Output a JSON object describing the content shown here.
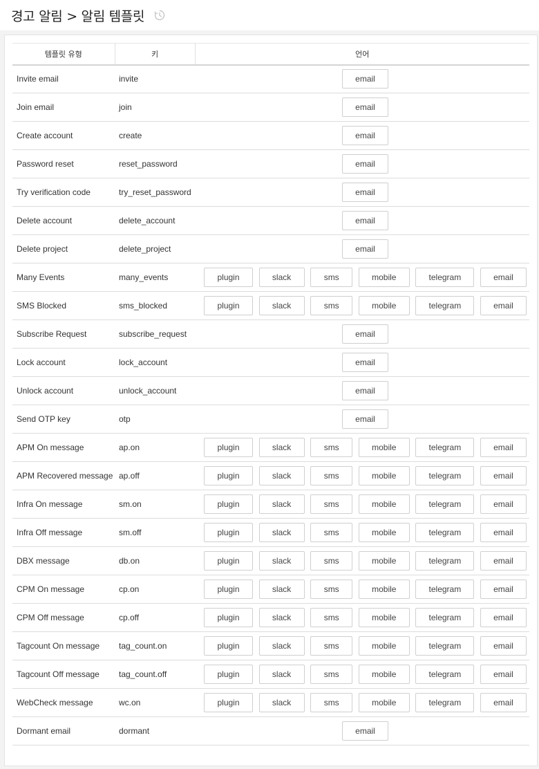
{
  "header": {
    "title": "경고 알림 > 알림 템플릿",
    "history_icon": "history-clock-icon"
  },
  "table": {
    "columns": [
      "템플릿 유형",
      "키",
      "언어"
    ],
    "rows": [
      {
        "type": "Invite email",
        "key": "invite",
        "langs": [
          "email"
        ]
      },
      {
        "type": "Join email",
        "key": "join",
        "langs": [
          "email"
        ]
      },
      {
        "type": "Create account",
        "key": "create",
        "langs": [
          "email"
        ]
      },
      {
        "type": "Password reset",
        "key": "reset_password",
        "langs": [
          "email"
        ]
      },
      {
        "type": "Try verification code",
        "key": "try_reset_password",
        "langs": [
          "email"
        ]
      },
      {
        "type": "Delete account",
        "key": "delete_account",
        "langs": [
          "email"
        ]
      },
      {
        "type": "Delete project",
        "key": "delete_project",
        "langs": [
          "email"
        ]
      },
      {
        "type": "Many Events",
        "key": "many_events",
        "langs": [
          "plugin",
          "slack",
          "sms",
          "mobile",
          "telegram",
          "email"
        ]
      },
      {
        "type": "SMS Blocked",
        "key": "sms_blocked",
        "langs": [
          "plugin",
          "slack",
          "sms",
          "mobile",
          "telegram",
          "email"
        ]
      },
      {
        "type": "Subscribe Request",
        "key": "subscribe_request",
        "langs": [
          "email"
        ]
      },
      {
        "type": "Lock account",
        "key": "lock_account",
        "langs": [
          "email"
        ]
      },
      {
        "type": "Unlock account",
        "key": "unlock_account",
        "langs": [
          "email"
        ]
      },
      {
        "type": "Send OTP key",
        "key": "otp",
        "langs": [
          "email"
        ]
      },
      {
        "type": "APM On message",
        "key": "ap.on",
        "langs": [
          "plugin",
          "slack",
          "sms",
          "mobile",
          "telegram",
          "email"
        ]
      },
      {
        "type": "APM Recovered message",
        "key": "ap.off",
        "langs": [
          "plugin",
          "slack",
          "sms",
          "mobile",
          "telegram",
          "email"
        ]
      },
      {
        "type": "Infra On message",
        "key": "sm.on",
        "langs": [
          "plugin",
          "slack",
          "sms",
          "mobile",
          "telegram",
          "email"
        ]
      },
      {
        "type": "Infra Off message",
        "key": "sm.off",
        "langs": [
          "plugin",
          "slack",
          "sms",
          "mobile",
          "telegram",
          "email"
        ]
      },
      {
        "type": "DBX message",
        "key": "db.on",
        "langs": [
          "plugin",
          "slack",
          "sms",
          "mobile",
          "telegram",
          "email"
        ]
      },
      {
        "type": "CPM On message",
        "key": "cp.on",
        "langs": [
          "plugin",
          "slack",
          "sms",
          "mobile",
          "telegram",
          "email"
        ]
      },
      {
        "type": "CPM Off message",
        "key": "cp.off",
        "langs": [
          "plugin",
          "slack",
          "sms",
          "mobile",
          "telegram",
          "email"
        ]
      },
      {
        "type": "Tagcount On message",
        "key": "tag_count.on",
        "langs": [
          "plugin",
          "slack",
          "sms",
          "mobile",
          "telegram",
          "email"
        ]
      },
      {
        "type": "Tagcount Off message",
        "key": "tag_count.off",
        "langs": [
          "plugin",
          "slack",
          "sms",
          "mobile",
          "telegram",
          "email"
        ]
      },
      {
        "type": "WebCheck message",
        "key": "wc.on",
        "langs": [
          "plugin",
          "slack",
          "sms",
          "mobile",
          "telegram",
          "email"
        ]
      },
      {
        "type": "Dormant email",
        "key": "dormant",
        "langs": [
          "email"
        ]
      }
    ]
  }
}
